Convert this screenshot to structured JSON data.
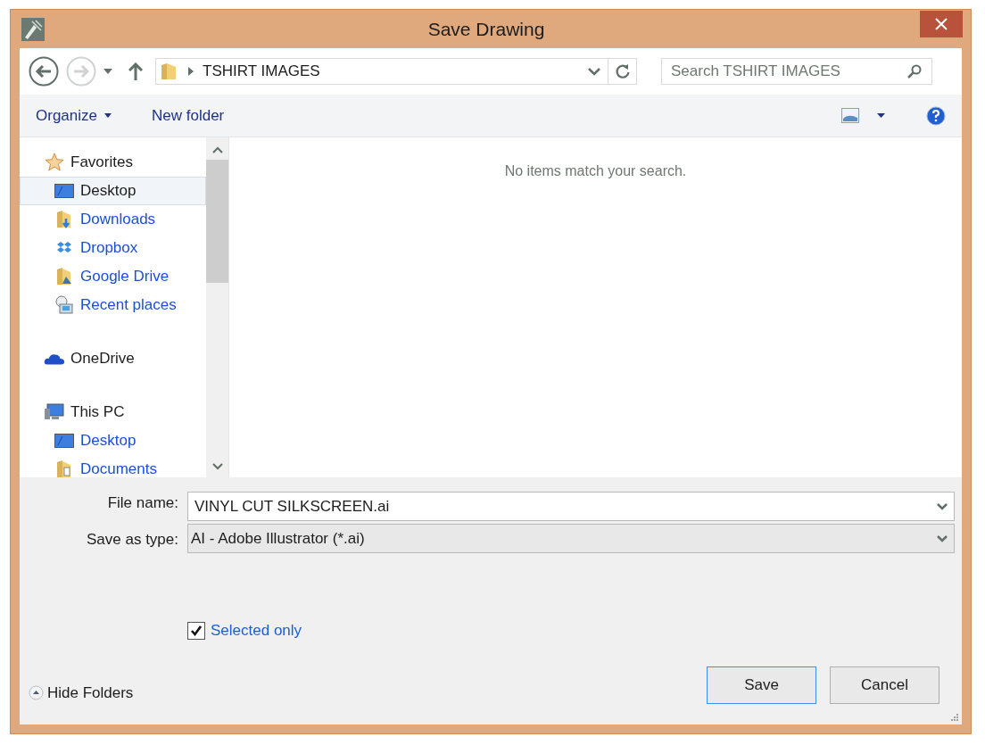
{
  "window": {
    "title": "Save Drawing"
  },
  "address_bar": {
    "path": "TSHIRT IMAGES"
  },
  "search": {
    "placeholder": "Search TSHIRT IMAGES"
  },
  "toolbar": {
    "organize": "Organize",
    "new_folder": "New folder"
  },
  "sidebar": {
    "items": [
      {
        "label": "Favorites",
        "kind": "star",
        "children": [
          {
            "label": "Desktop",
            "kind": "desktop",
            "selected": true
          },
          {
            "label": "Downloads",
            "kind": "downloads",
            "selected": false
          },
          {
            "label": "Dropbox",
            "kind": "dropbox",
            "selected": false
          },
          {
            "label": "Google Drive",
            "kind": "drive",
            "selected": false
          },
          {
            "label": "Recent places",
            "kind": "recent",
            "selected": false
          }
        ]
      },
      {
        "label": "OneDrive",
        "kind": "cloud"
      },
      {
        "label": "This PC",
        "kind": "pc",
        "children": [
          {
            "label": "Desktop",
            "kind": "desktop",
            "selected": false
          },
          {
            "label": "Documents",
            "kind": "documents",
            "selected": false
          }
        ]
      }
    ]
  },
  "content": {
    "message": "No items match your search."
  },
  "form": {
    "file_name_label": "File name:",
    "file_name": "VINYL CUT SILKSCREEN.ai",
    "type_label": "Save as type:",
    "type": "AI - Adobe Illustrator (*.ai)"
  },
  "selected_only": {
    "label": "Selected only",
    "checked": true
  },
  "hide_folders": "Hide Folders",
  "buttons": [
    {
      "label": "Save",
      "default": true
    },
    {
      "label": "Cancel",
      "default": false
    }
  ]
}
